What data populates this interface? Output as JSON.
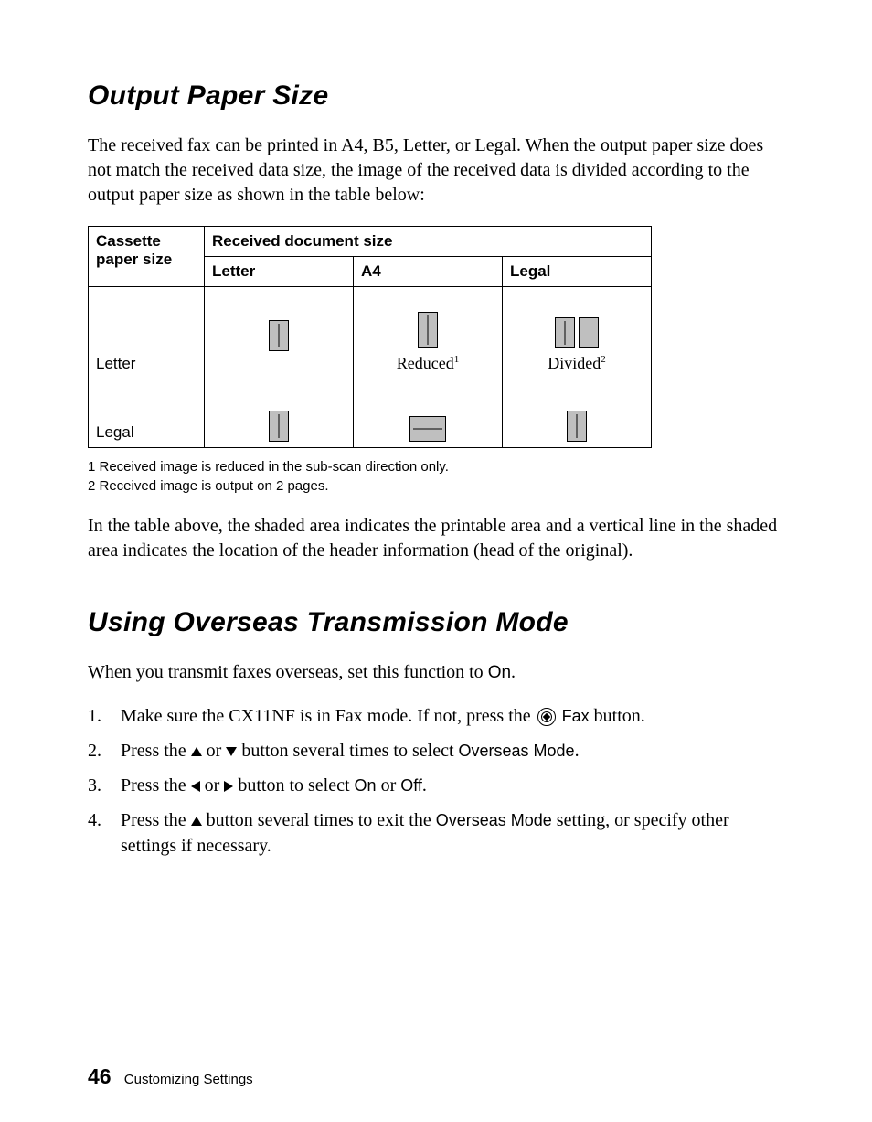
{
  "section1": {
    "title": "Output Paper Size",
    "intro": "The received fax can be printed in A4, B5, Letter, or Legal. When the output paper size does not match the received data size, the image of the received data is divided according to the output paper size as shown in the table below:",
    "table": {
      "corner_label_line1": "Cassette",
      "corner_label_line2": "paper size",
      "header_span": "Received document size",
      "col_headers": [
        "Letter",
        "A4",
        "Legal"
      ],
      "row_labels": [
        "Letter",
        "Legal"
      ],
      "captions": {
        "reduced": "Reduced",
        "reduced_sup": "1",
        "divided": "Divided",
        "divided_sup": "2"
      }
    },
    "footnote1": "1   Received image is reduced in the sub-scan direction only.",
    "footnote2": "2   Received image is output on 2 pages.",
    "outro": "In the table above, the shaded area indicates the printable area and a vertical line in the shaded area indicates the location of the header information (head of the original)."
  },
  "section2": {
    "title": "Using Overseas Transmission Mode",
    "intro_before": "When you transmit faxes overseas, set this function to ",
    "intro_on": "On",
    "intro_after": ".",
    "steps": {
      "s1_a": "Make sure the CX11NF is in Fax mode. If not, press the ",
      "s1_b": "Fax",
      "s1_c": " button.",
      "s2_a": "Press the ",
      "s2_b": " or ",
      "s2_c": " button several times to select ",
      "s2_d": "Overseas Mode",
      "s2_e": ".",
      "s3_a": "Press the ",
      "s3_b": " or ",
      "s3_c": " button to select ",
      "s3_d": "On",
      "s3_e": " or ",
      "s3_f": "Off",
      "s3_g": ".",
      "s4_a": "Press the ",
      "s4_b": " button several times to exit the ",
      "s4_c": "Overseas Mode",
      "s4_d": " setting, or specify other settings if necessary."
    }
  },
  "footer": {
    "page_number": "46",
    "chapter": "Customizing Settings"
  }
}
